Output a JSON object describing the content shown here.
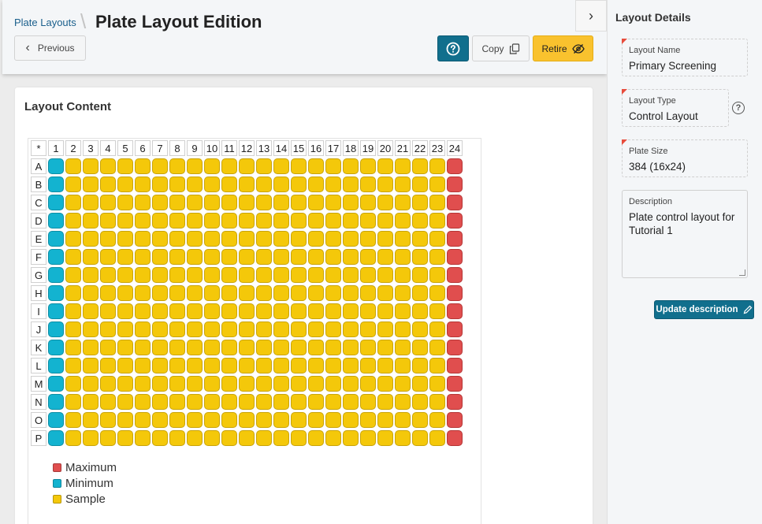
{
  "header": {
    "breadcrumb": "Plate Layouts",
    "title": "Plate Layout Edition",
    "previous_label": "Previous",
    "copy_label": "Copy",
    "retire_label": "Retire"
  },
  "content": {
    "title": "Layout Content",
    "plate": {
      "corner": "*",
      "columns": [
        "1",
        "2",
        "3",
        "4",
        "5",
        "6",
        "7",
        "8",
        "9",
        "10",
        "11",
        "12",
        "13",
        "14",
        "15",
        "16",
        "17",
        "18",
        "19",
        "20",
        "21",
        "22",
        "23",
        "24"
      ],
      "rows": [
        "A",
        "B",
        "C",
        "D",
        "E",
        "F",
        "G",
        "H",
        "I",
        "J",
        "K",
        "L",
        "M",
        "N",
        "O",
        "P"
      ],
      "column_types": {
        "1": "minimum",
        "24": "maximum",
        "default": "sample"
      },
      "colors": {
        "sample": "#f4c80a",
        "minimum": "#13b3d0",
        "maximum": "#e04e4e"
      }
    },
    "legend": [
      {
        "label": "Maximum",
        "color": "#e04e4e"
      },
      {
        "label": "Minimum",
        "color": "#13b3d0"
      },
      {
        "label": "Sample",
        "color": "#f4c80a"
      }
    ]
  },
  "sidebar": {
    "title": "Layout Details",
    "layout_name_label": "Layout Name",
    "layout_name": "Primary Screening",
    "layout_type_label": "Layout Type",
    "layout_type": "Control Layout",
    "plate_size_label": "Plate Size",
    "plate_size": "384 (16x24)",
    "description_label": "Description",
    "description": "Plate control layout for Tutorial 1",
    "update_label": "Update description"
  }
}
